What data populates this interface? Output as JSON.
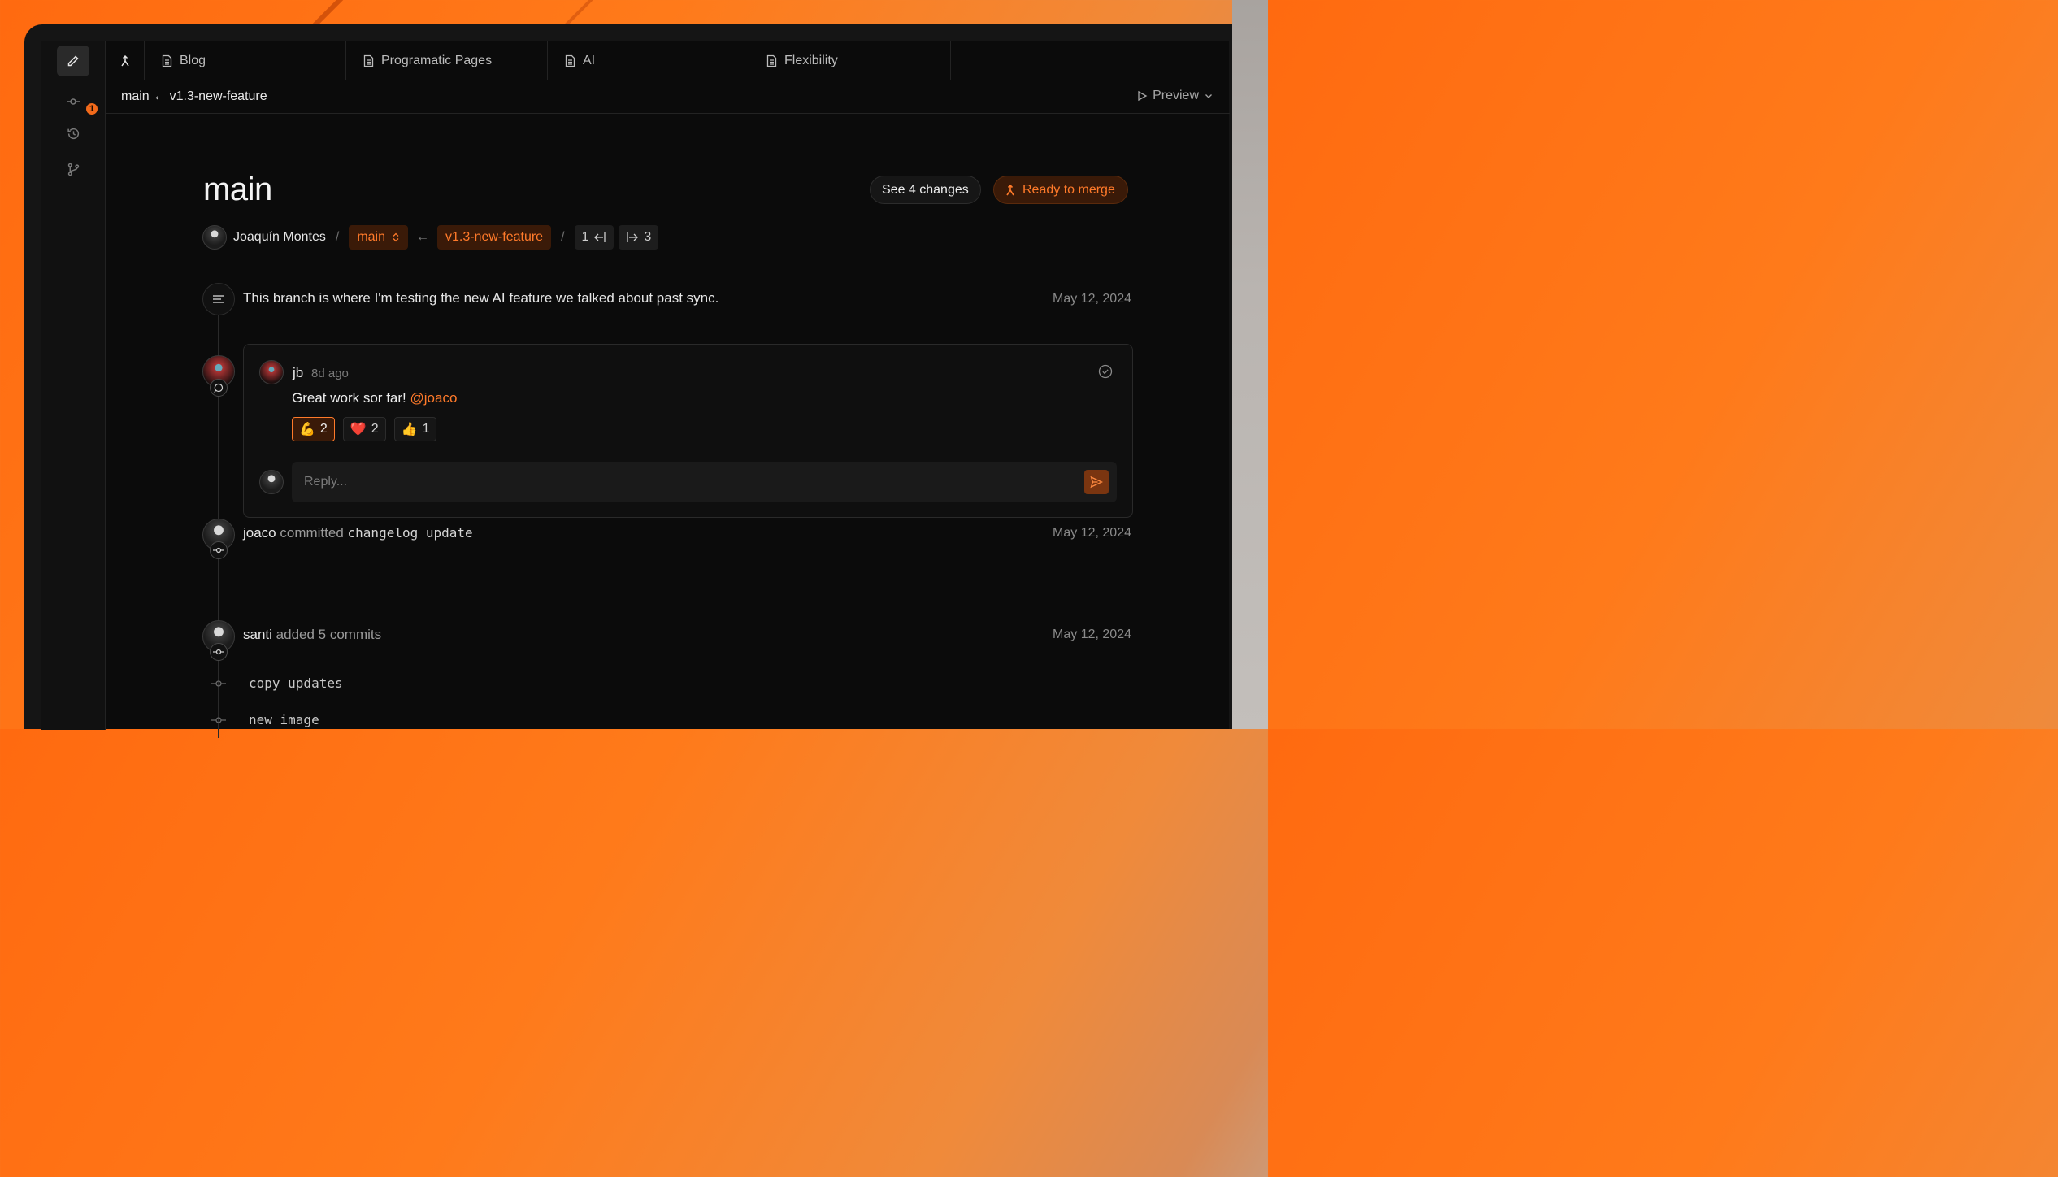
{
  "tabs": [
    {
      "label": "Blog",
      "icon": "document-icon"
    },
    {
      "label": "Programatic Pages",
      "icon": "document-icon"
    },
    {
      "label": "AI",
      "icon": "document-icon"
    },
    {
      "label": "Flexibility",
      "icon": "document-icon"
    }
  ],
  "rail": {
    "badge_count": "1"
  },
  "branchbar": {
    "path": "main ← v1.3-new-feature",
    "preview_label": "Preview"
  },
  "header": {
    "title": "main",
    "see_changes": "See 4 changes",
    "merge_label": "Ready to merge"
  },
  "meta": {
    "author": "Joaquín Montes",
    "base_branch": "main",
    "head_branch": "v1.3-new-feature",
    "behind": "1",
    "ahead": "3"
  },
  "description": {
    "text": "This branch is where I'm testing the new AI feature we talked about past sync.",
    "date": "May 12, 2024"
  },
  "comment": {
    "author": "jb",
    "time": "8d ago",
    "text": "Great work sor far!",
    "mention": "@joaco",
    "reactions": [
      {
        "emoji": "💪",
        "count": "2",
        "selected": true
      },
      {
        "emoji": "❤️",
        "count": "2",
        "selected": false
      },
      {
        "emoji": "👍",
        "count": "1",
        "selected": false
      }
    ],
    "reply_placeholder": "Reply..."
  },
  "events": [
    {
      "user": "joaco",
      "action": "committed",
      "detail": "changelog update",
      "date": "May 12, 2024"
    },
    {
      "user": "santi",
      "action": "added 5 commits",
      "date": "May 12, 2024"
    }
  ],
  "commits": [
    "copy updates",
    "new image"
  ],
  "colors": {
    "accent": "#ff7a2a",
    "accent_bg": "#3a1a08",
    "background": "#0b0b0b"
  }
}
